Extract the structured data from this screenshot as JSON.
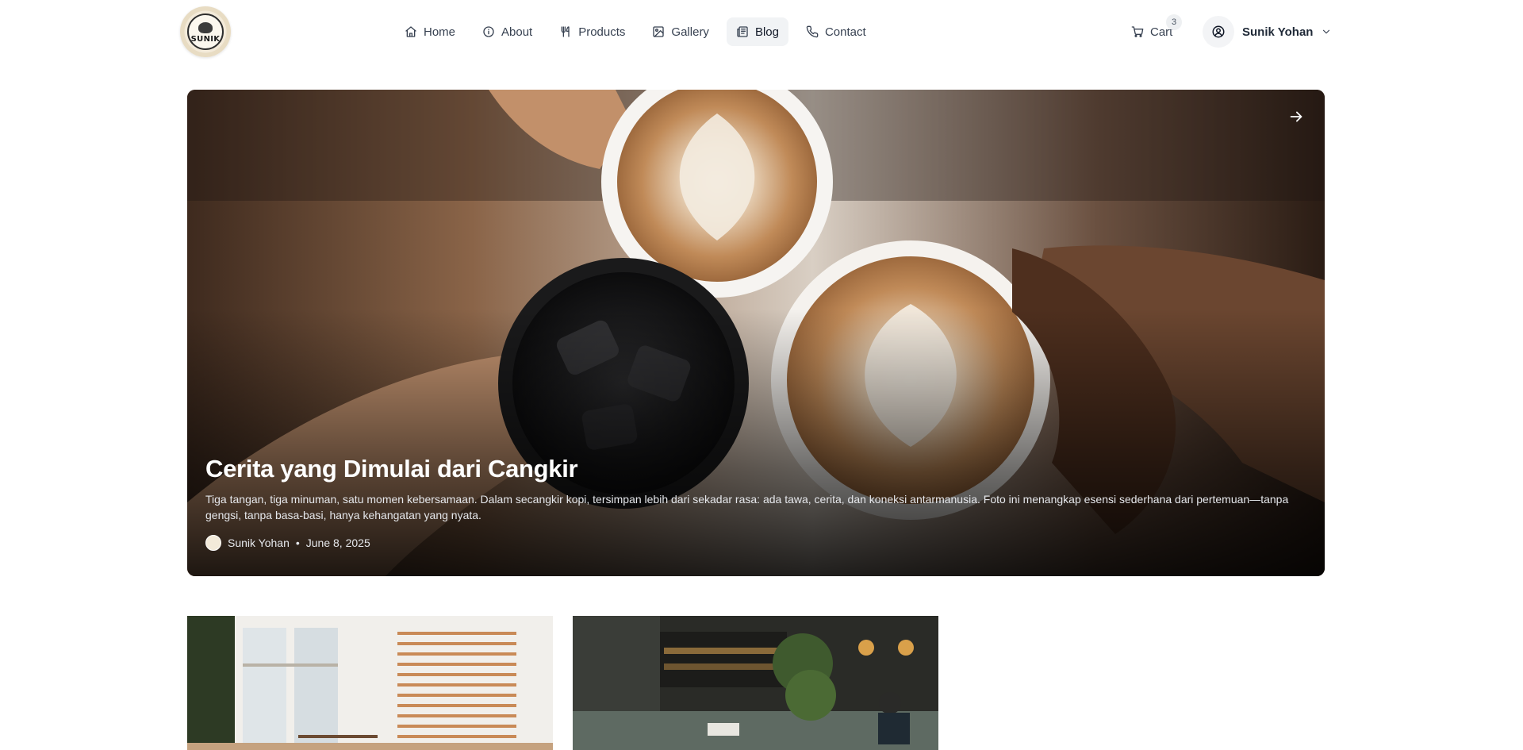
{
  "brand": {
    "logo_text": "SUNIK"
  },
  "nav": {
    "items": [
      {
        "label": "Home",
        "icon": "home-icon"
      },
      {
        "label": "About",
        "icon": "info-icon"
      },
      {
        "label": "Products",
        "icon": "utensils-icon"
      },
      {
        "label": "Gallery",
        "icon": "image-icon"
      },
      {
        "label": "Blog",
        "icon": "newspaper-icon",
        "active": true
      },
      {
        "label": "Contact",
        "icon": "phone-icon"
      }
    ]
  },
  "cart": {
    "label": "Cart",
    "count": "3",
    "icon": "shopping-cart-icon"
  },
  "user": {
    "name": "Sunik Yohan",
    "icon": "user-circle-icon"
  },
  "hero": {
    "title": "Cerita yang Dimulai dari Cangkir",
    "excerpt": "Tiga tangan, tiga minuman, satu momen kebersamaan. Dalam secangkir kopi, tersimpan lebih dari sekadar rasa: ada tawa, cerita, dan koneksi antarmanusia. Foto ini menangkap esensi sederhana dari pertemuan—tanpa gengsi, tanpa basa-basi, hanya kehangatan yang nyata.",
    "author": "Sunik Yohan",
    "separator": "•",
    "date": "June 8, 2025"
  },
  "colors": {
    "accent_bg": "#f1f3f5",
    "text": "#1f2937",
    "hero_text": "#ffffff"
  }
}
